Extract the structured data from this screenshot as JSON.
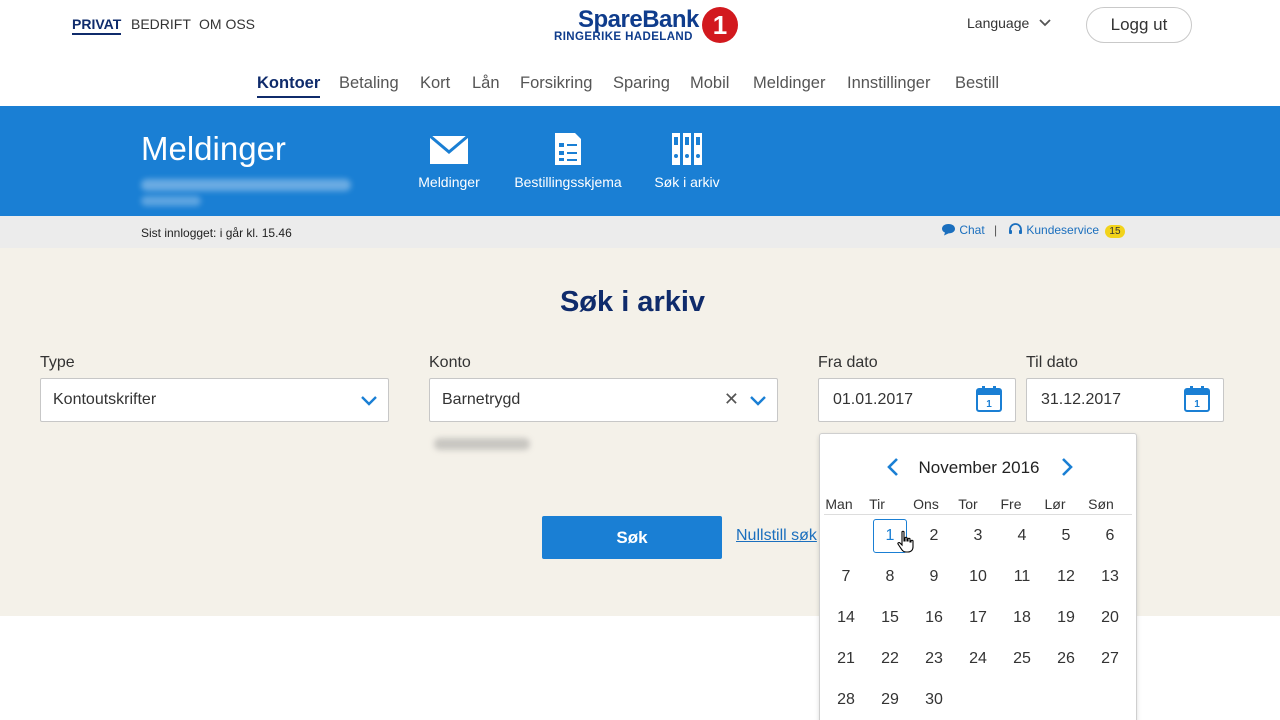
{
  "header": {
    "segments": [
      "PRIVAT",
      "BEDRIFT",
      "OM OSS"
    ],
    "logo": {
      "name": "SpareBank",
      "badge": "1",
      "sub": "RINGERIKE HADELAND"
    },
    "language_label": "Language",
    "logout_label": "Logg ut"
  },
  "nav": {
    "items": [
      "Kontoer",
      "Betaling",
      "Kort",
      "Lån",
      "Forsikring",
      "Sparing",
      "Mobil",
      "Meldinger",
      "Innstillinger",
      "Bestill"
    ]
  },
  "band": {
    "title": "Meldinger",
    "links": [
      "Meldinger",
      "Bestillingsskjema",
      "Søk i arkiv"
    ]
  },
  "infobar": {
    "last_login": "Sist innlogget: i går kl. 15.46",
    "chat_label": "Chat",
    "separator": "|",
    "service_label": "Kundeservice",
    "service_count": "15"
  },
  "search": {
    "title": "Søk i arkiv",
    "type_label": "Type",
    "type_value": "Kontoutskrifter",
    "konto_label": "Konto",
    "konto_value": "Barnetrygd",
    "fra_label": "Fra dato",
    "fra_value": "01.01.2017",
    "til_label": "Til dato",
    "til_value": "31.12.2017",
    "search_button": "Søk",
    "reset_link": "Nullstill søk"
  },
  "calendar": {
    "month_label": "November 2016",
    "weekdays": [
      "Man",
      "Tir",
      "Ons",
      "Tor",
      "Fre",
      "Lør",
      "Søn"
    ],
    "selected_day": "1",
    "weeks": [
      [
        "",
        "1",
        "2",
        "3",
        "4",
        "5",
        "6"
      ],
      [
        "7",
        "8",
        "9",
        "10",
        "11",
        "12",
        "13"
      ],
      [
        "14",
        "15",
        "16",
        "17",
        "18",
        "19",
        "20"
      ],
      [
        "21",
        "22",
        "23",
        "24",
        "25",
        "26",
        "27"
      ],
      [
        "28",
        "29",
        "30",
        "",
        "",
        "",
        ""
      ]
    ]
  },
  "colors": {
    "brand_blue": "#1a7fd4",
    "navy": "#0f2b6b",
    "logo_red": "#d2191e",
    "beige": "#f4f1e9"
  }
}
